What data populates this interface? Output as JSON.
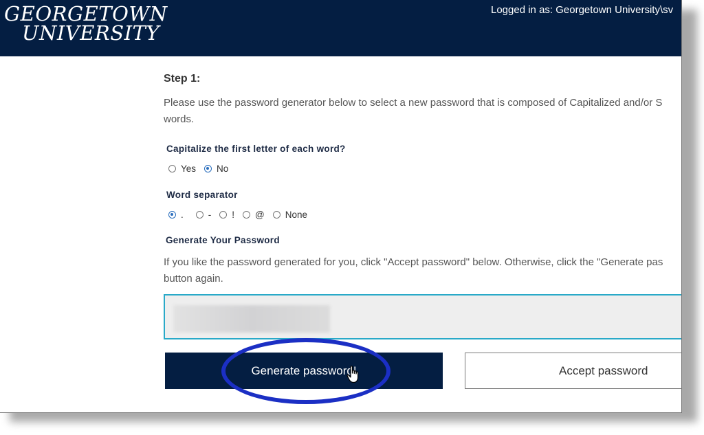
{
  "header": {
    "logo_line1": "GEORGETOWN",
    "logo_line2": "UNIVERSITY",
    "login_status": "Logged in as: Georgetown University\\sv"
  },
  "step": {
    "title": "Step 1:",
    "intro": "Please use the password generator below to select a new password that is composed of Capitalized and/or S words."
  },
  "capitalize": {
    "label": "Capitalize the first letter of each word?",
    "options": [
      {
        "label": "Yes",
        "checked": false
      },
      {
        "label": "No",
        "checked": true
      }
    ]
  },
  "separator": {
    "label": "Word separator",
    "options": [
      {
        "label": ".",
        "checked": true
      },
      {
        "label": "-",
        "checked": false
      },
      {
        "label": "!",
        "checked": false
      },
      {
        "label": "@",
        "checked": false
      },
      {
        "label": "None",
        "checked": false
      }
    ]
  },
  "generate": {
    "label": "Generate Your Password",
    "text": "If you like the password generated for you, click \"Accept password\" below. Otherwise, click the \"Generate pas button again."
  },
  "buttons": {
    "generate": "Generate password!",
    "accept": "Accept password"
  },
  "colors": {
    "navy": "#041e42",
    "highlight": "#1b2fc4",
    "input_border": "#29a9c8"
  }
}
